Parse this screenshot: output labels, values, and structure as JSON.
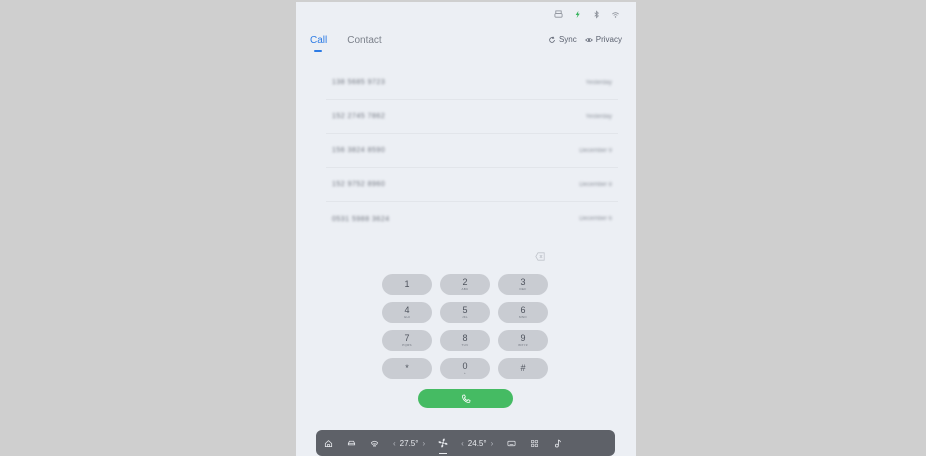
{
  "status_icons": [
    "printer-icon",
    "charging-icon",
    "bluetooth-icon",
    "wifi-icon"
  ],
  "tabs": [
    {
      "label": "Call",
      "active": true
    },
    {
      "label": "Contact",
      "active": false
    }
  ],
  "header_actions": {
    "sync_label": "Sync",
    "privacy_label": "Privacy"
  },
  "calls": [
    {
      "number": "138 5685 9723",
      "time": "Yesterday"
    },
    {
      "number": "152 2745 7862",
      "time": "Yesterday"
    },
    {
      "number": "156 3824 8590",
      "time": "December 9"
    },
    {
      "number": "152 9752 8960",
      "time": "December 8"
    },
    {
      "number": "0531 5988 3624",
      "time": "December 6"
    }
  ],
  "keypad": [
    {
      "digit": "1",
      "sub": ""
    },
    {
      "digit": "2",
      "sub": "ABC"
    },
    {
      "digit": "3",
      "sub": "DEF"
    },
    {
      "digit": "4",
      "sub": "GHI"
    },
    {
      "digit": "5",
      "sub": "JKL"
    },
    {
      "digit": "6",
      "sub": "MNO"
    },
    {
      "digit": "7",
      "sub": "PQRS"
    },
    {
      "digit": "8",
      "sub": "TUV"
    },
    {
      "digit": "9",
      "sub": "WXYZ"
    },
    {
      "digit": "*",
      "sub": ""
    },
    {
      "digit": "0",
      "sub": "+"
    },
    {
      "digit": "#",
      "sub": ""
    }
  ],
  "dock": {
    "left_temp": "27.5°",
    "right_temp": "24.5°",
    "chevron_left": "‹",
    "chevron_right": "›"
  },
  "colors": {
    "accent": "#2c7be5",
    "call_green": "#45bb63",
    "dock_bg": "#5e6168"
  }
}
